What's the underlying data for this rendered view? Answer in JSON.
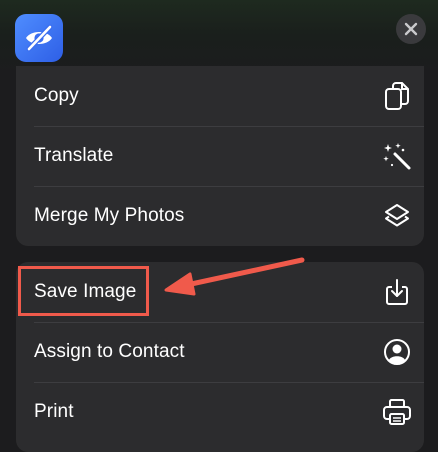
{
  "header": {
    "app_icon": "eye-slash-icon",
    "close_icon": "close-icon"
  },
  "menu_group_1": [
    {
      "label": "Copy",
      "icon": "copy-icon"
    },
    {
      "label": "Translate",
      "icon": "magic-wand-icon"
    },
    {
      "label": "Merge My Photos",
      "icon": "layers-icon"
    }
  ],
  "menu_group_2": [
    {
      "label": "Save Image",
      "icon": "download-icon"
    },
    {
      "label": "Assign to Contact",
      "icon": "person-circle-icon"
    },
    {
      "label": "Print",
      "icon": "printer-icon"
    }
  ],
  "annotation": {
    "highlight_color": "#f05a4b",
    "target": "Save Image"
  },
  "colors": {
    "background": "#1c1c1e",
    "menu_bg": "#2c2c2e",
    "app_icon_blue": "#3b73f5"
  }
}
